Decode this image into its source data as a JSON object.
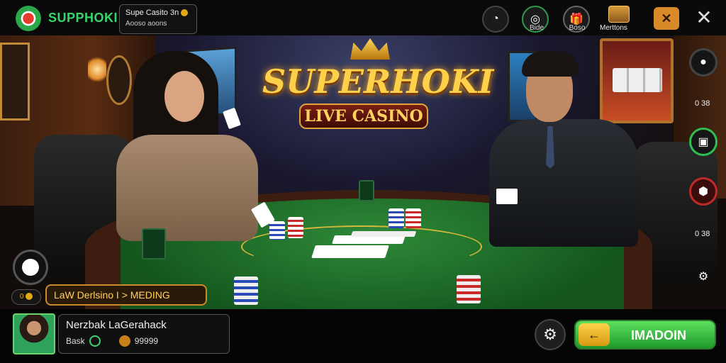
{
  "header": {
    "brand": "SUPPHOKI",
    "info_line1": "Supe Casito 3n",
    "info_line2": "Aooso aoons",
    "icons": [
      {
        "name": "timer-icon",
        "label": ""
      },
      {
        "name": "badge-icon",
        "label": "Bide"
      },
      {
        "name": "gift-icon",
        "label": "Boso"
      },
      {
        "name": "chest-icon",
        "label": "Merttons"
      }
    ],
    "mentions_label": "Merttons"
  },
  "scene": {
    "title": "SUPERHOKI",
    "subtitle": "LIVE CASINO",
    "crown_text": "",
    "side_values": [
      "0 38",
      "0 38"
    ]
  },
  "overlay": {
    "coins_badge": "0 ",
    "status_text": "LaW Derlsino   I > MEDING"
  },
  "player": {
    "name": "Nerzbak LaGerahack",
    "stat_label": "Bask",
    "stat_value": "99999"
  },
  "footer": {
    "play_label": "IMADOIN",
    "arrow": "←"
  },
  "colors": {
    "accent_green": "#36d66b",
    "gold": "#ffd04a",
    "orange": "#d98a28"
  }
}
